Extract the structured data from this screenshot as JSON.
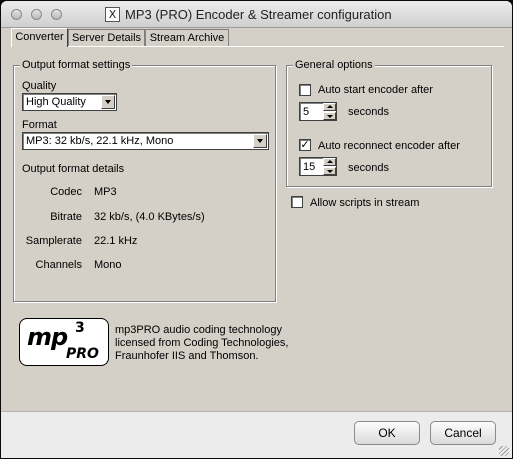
{
  "window": {
    "title": "MP3 (PRO) Encoder & Streamer configuration",
    "app_icon_glyph": "X"
  },
  "tabs": [
    {
      "label": "Converter",
      "active": true
    },
    {
      "label": "Server Details",
      "active": false
    },
    {
      "label": "Stream Archive",
      "active": false
    }
  ],
  "output_format": {
    "group_label": "Output format settings",
    "quality_label": "Quality",
    "quality_value": "High Quality",
    "format_label": "Format",
    "format_value": "MP3: 32 kb/s, 22.1 kHz, Mono",
    "details_label": "Output format details",
    "details": [
      {
        "key": "Codec",
        "value": "MP3"
      },
      {
        "key": "Bitrate",
        "value": "32 kb/s, (4.0 KBytes/s)"
      },
      {
        "key": "Samplerate",
        "value": "22.1 kHz"
      },
      {
        "key": "Channels",
        "value": "Mono"
      }
    ]
  },
  "general_options": {
    "group_label": "General options",
    "auto_start_label": "Auto start encoder after",
    "auto_start_checked": false,
    "auto_start_seconds": "5",
    "auto_start_unit": "seconds",
    "auto_reconnect_label": "Auto reconnect encoder after",
    "auto_reconnect_checked": true,
    "auto_reconnect_seconds": "15",
    "auto_reconnect_unit": "seconds"
  },
  "allow_scripts": {
    "label": "Allow scripts in stream",
    "checked": false
  },
  "logo": {
    "text_main": "mp",
    "text_sup": "3",
    "text_pro": "PRO"
  },
  "license_lines": [
    "mp3PRO audio coding technology",
    "licensed from Coding Technologies,",
    "Fraunhofer IIS and Thomson."
  ],
  "buttons": {
    "ok": "OK",
    "cancel": "Cancel"
  },
  "icons": {
    "close": "close-icon",
    "minimize": "minimize-icon",
    "zoom": "zoom-icon",
    "check": "checkmark-icon",
    "dropdown": "chevron-down-icon"
  }
}
